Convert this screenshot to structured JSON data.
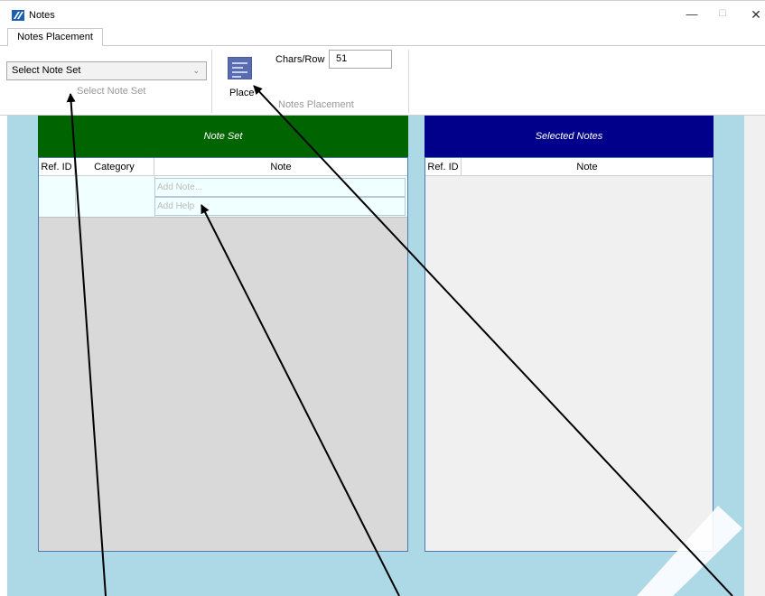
{
  "window": {
    "title": "Notes",
    "minimize_glyph": "—",
    "maximize_glyph": "☐",
    "close_glyph": "✕"
  },
  "tabs": [
    {
      "label": "Notes Placement"
    }
  ],
  "ribbon": {
    "note_set_select": {
      "value": "Select Note Set"
    },
    "note_set_group_label": "Select Note Set",
    "place_button_label": "Place",
    "chars_per_row_label": "Chars/Row",
    "chars_per_row_value": "51",
    "notes_placement_group_label": "Notes Placement"
  },
  "note_set_panel": {
    "title": "Note Set",
    "columns": [
      "Ref. ID",
      "Category",
      "Note"
    ],
    "add_note_placeholder": "Add Note...",
    "add_help_placeholder": "Add Help"
  },
  "selected_notes_panel": {
    "title": "Selected Notes",
    "columns": [
      "Ref. ID",
      "Note"
    ]
  },
  "icons": {
    "app": "app-logo-icon",
    "place": "notes-list-icon",
    "dropdown": "chevron-down-icon"
  },
  "colors": {
    "content_bg": "#add8e6",
    "note_set_header": "#006400",
    "selected_notes_header": "#00008b",
    "edit_row_bg": "#f0ffff",
    "panel_border": "#4a7ab0",
    "note_set_body": "#d9d9d9",
    "selected_notes_body": "#f0f0f0"
  }
}
